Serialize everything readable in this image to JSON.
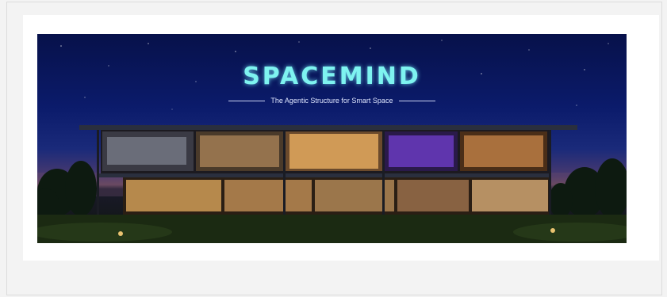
{
  "banner": {
    "logo_text": "SPACEMIND",
    "tagline": "The Agentic Structure for Smart Space"
  },
  "colors": {
    "page_bg": "#f3f3f3",
    "card_bg": "#ffffff",
    "sky_top": "#07114a",
    "logo_cyan": "#7ef3f0",
    "window_warm": "#f2b664",
    "window_purple": "#8a4cff",
    "lawn": "#1b2a12"
  }
}
